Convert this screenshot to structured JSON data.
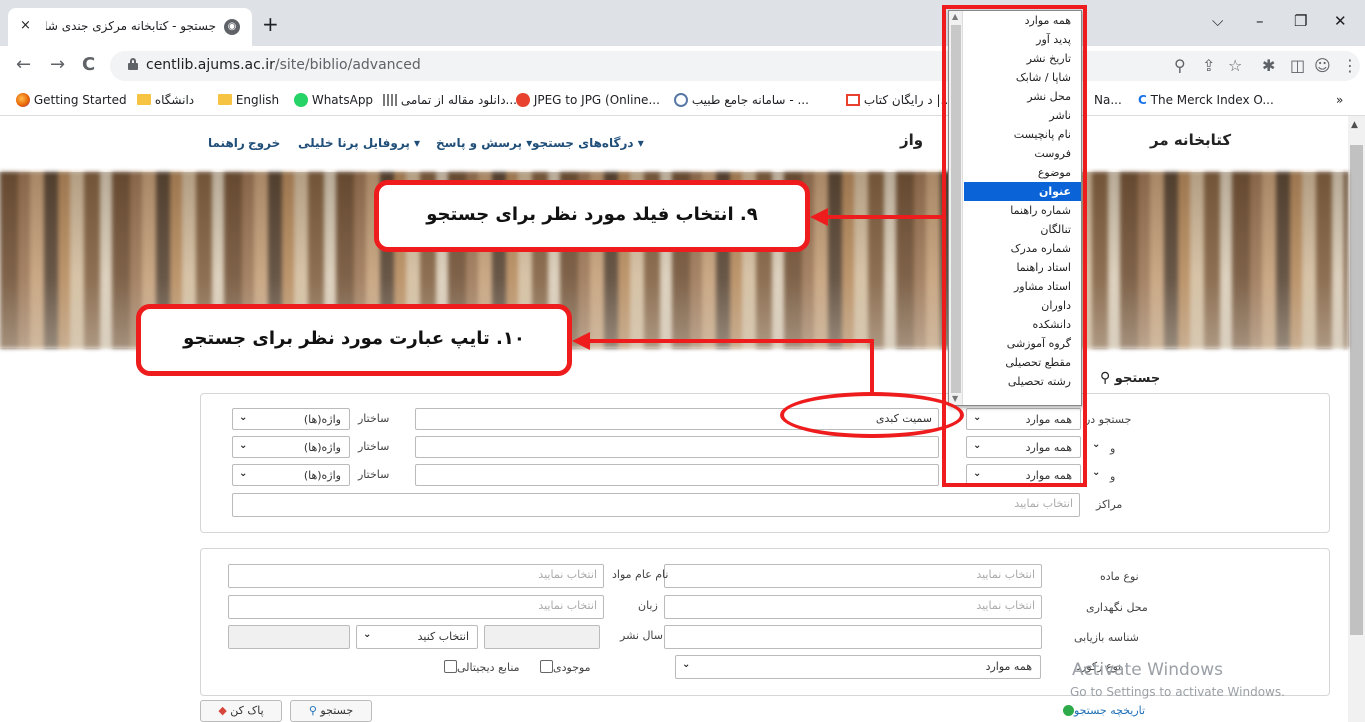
{
  "browser": {
    "tab_title": "جستجو - کتابخانه مرکزی جندی شاپور",
    "tab_close": "×",
    "new_tab": "+",
    "url_host": "centlib.ajums.ac.ir",
    "url_path": "/site/biblio/advanced",
    "controls": {
      "chevron": "⌵",
      "minimize": "–",
      "restore": "❐",
      "close": "✕"
    },
    "nav": {
      "back": "←",
      "forward": "→",
      "reload": "C"
    },
    "bookmarks": [
      {
        "label": "Getting Started",
        "icon": "firefox-icon"
      },
      {
        "label": "دانشگاه",
        "icon": "folder-icon"
      },
      {
        "label": "English",
        "icon": "folder-icon"
      },
      {
        "label": "WhatsApp",
        "icon": "whatsapp-icon"
      },
      {
        "label": "دانلود مقاله از تمامی...",
        "icon": "bars-icon"
      },
      {
        "label": "JPEG to JPG (Online...",
        "icon": "red-circle-icon"
      },
      {
        "label": "سامانه جامع طبیب - ...",
        "icon": "gray-circle-icon"
      },
      {
        "label": "د رایگان کتاب |...",
        "icon": "red-box-icon"
      },
      {
        "label": "Na...",
        "icon": ""
      },
      {
        "label": "The Merck Index O...",
        "icon": "merck-icon"
      }
    ],
    "bookmarks_overflow": "»"
  },
  "site": {
    "title": "کتابخانه مر",
    "title_tail": "واز",
    "nav": [
      {
        "label": "راهنما"
      },
      {
        "label": "خروج"
      },
      {
        "label": "پروفایل پرنا خلیلی ▾"
      },
      {
        "label": "پرسش و پاسخ ▾"
      },
      {
        "label": "درگاه‌های جستجو ▾"
      }
    ],
    "section_title": "جستجو"
  },
  "dropdown": {
    "items": [
      "همه موارد",
      "پدید آور",
      "تاریخ نشر",
      "شاپا / شابک",
      "محل نشر",
      "ناشر",
      "نام پانچیست",
      "فروست",
      "موضوع",
      "عنوان",
      "شماره راهنما",
      "تنالگان",
      "شماره مدرک",
      "استاد راهنما",
      "استاد مشاور",
      "داوران",
      "دانشکده",
      "گروه آموزشی",
      "مقطع تحصیلی",
      "رشته تحصیلی"
    ],
    "selected_index": 9
  },
  "search": {
    "search_in_label": "جستجو در",
    "rows": [
      {
        "field": "همه موارد",
        "operator": "",
        "query": "سمیت کبدی",
        "structure_label": "ساختار",
        "structure": "واژه(ها)"
      },
      {
        "field": "همه موارد",
        "operator": "و",
        "query": "",
        "structure_label": "ساختار",
        "structure": "واژه(ها)"
      },
      {
        "field": "همه موارد",
        "operator": "و",
        "query": "",
        "structure_label": "ساختار",
        "structure": "واژه(ها)"
      }
    ],
    "centers_label": "مراکز",
    "centers_placeholder": "انتخاب نمایید"
  },
  "filters": {
    "material_type_label": "نوع ماده",
    "material_type_ph": "انتخاب نمایید",
    "general_name_label": "نام عام مواد",
    "general_name_ph": "انتخاب نمایید",
    "location_label": "محل نگهداری",
    "location_ph": "انتخاب نمایید",
    "language_label": "زبان",
    "language_ph": "انتخاب نمایید",
    "retrieval_id_label": "شناسه بازیابی",
    "pub_year_label": "سال نشر",
    "select_label": "انتخاب کنید",
    "record_type_label": "نوع رکورد",
    "record_type_value": "همه موارد",
    "available_label": "موجودی",
    "digital_label": "منابع دیجیتالی"
  },
  "buttons": {
    "search": "جستجو",
    "clear": "پاک کن",
    "history": "تاریخچه جستجو"
  },
  "watermark": {
    "line1": "Activate Windows",
    "line2": "Go to Settings to activate Windows."
  },
  "annotations": {
    "callout9": "۹. انتخاب فیلد مورد نظر برای جستجو",
    "callout10": "۱۰. تایپ عبارت مورد نظر برای جستجو"
  },
  "colors": {
    "accent_red": "#ee1c1c",
    "selected_blue": "#0a64d8"
  }
}
